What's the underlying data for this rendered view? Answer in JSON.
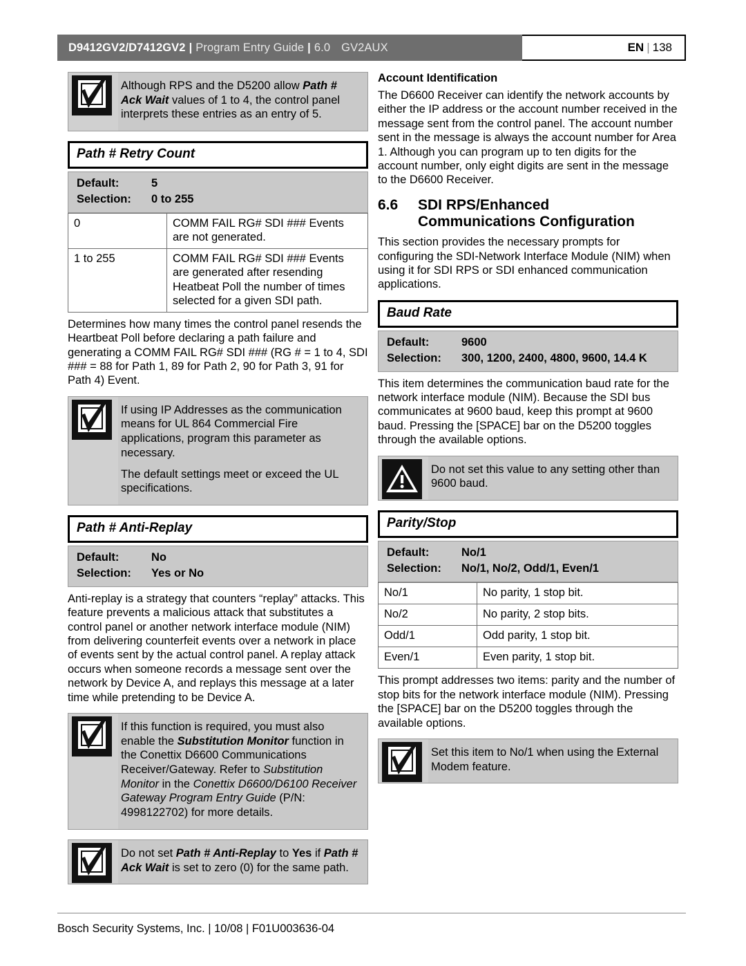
{
  "header": {
    "product": "D9412GV2/D7412GV2",
    "separator": "|",
    "guide": "Program Entry Guide",
    "version": "6.0",
    "aux": "GV2AUX",
    "language": "EN",
    "page_number": "138",
    "bar_color": "#6e6e6e"
  },
  "footer": {
    "text": "Bosch Security Systems, Inc. | 10/08 | F01U003636-04"
  },
  "left_column": {
    "note_ack_wait": {
      "icon": "notice-checkbox-icon",
      "text_run_1": "Although RPS and the D5200 allow ",
      "text_bold_1": "Path # Ack Wait",
      "text_run_2": " values of 1 to 4, the control panel interprets these entries as an entry of 5."
    },
    "retry_count": {
      "title": "Path # Retry Count",
      "default_label": "Default:",
      "default_value": "5",
      "selection_label": "Selection:",
      "selection_value": "0 to 255",
      "rows": [
        {
          "value": "0",
          "description": "COMM FAIL RG# SDI ### Events are not generated."
        },
        {
          "value": "1 to 255",
          "description": "COMM FAIL RG# SDI ### Events are generated after resending Heatbeat Poll the number of times selected for a given SDI path."
        }
      ],
      "body": "Determines how many times the control panel resends the Heartbeat Poll before declaring a path failure and generating a COMM FAIL RG# SDI ### (RG # = 1 to 4, SDI ### = 88 for Path 1, 89 for Path 2, 90 for Path 3, 91 for Path 4) Event."
    },
    "note_ul864": {
      "icon": "notice-checkbox-icon",
      "paragraph_1": "If using IP Addresses as the communication means for UL 864 Commercial Fire applications, program this parameter as necessary.",
      "paragraph_2": "The default settings meet or exceed the UL specifications."
    },
    "anti_replay": {
      "title": "Path # Anti-Replay",
      "default_label": "Default:",
      "default_value": "No",
      "selection_label": "Selection:",
      "selection_value": "Yes or No",
      "body": "Anti-replay is a strategy that counters “replay” attacks. This feature prevents a malicious attack that substitutes a control panel or another network interface module (NIM) from delivering counterfeit events over a network in place of events sent by the actual control panel. A replay attack occurs when someone records a message sent over the network by Device A, and replays this message at a later time while pretending to be Device A."
    },
    "note_substitution": {
      "icon": "notice-checkbox-icon",
      "run_1": "If this function is required, you must also enable the ",
      "bold_1": "Substitution Monitor",
      "run_2": " function in the Conettix D6600 Communications Receiver/Gateway. Refer to ",
      "italic_1": "Substitution Monitor",
      "run_3": " in the ",
      "italic_2": "Conettix D6600/D6100 Receiver Gateway Program Entry Guide",
      "run_4": " (P/N: 4998122702) for more details."
    },
    "note_no_yes": {
      "icon": "notice-checkbox-icon",
      "run_1": "Do not set ",
      "bold_1": "Path # Anti-Replay",
      "run_2": " to ",
      "bold_2": "Yes",
      "run_3": " if ",
      "bold_3": "Path # Ack Wait",
      "run_4": " is set to zero (0) for the same path."
    }
  },
  "right_column": {
    "account_identification": {
      "heading": "Account Identification",
      "body": "The D6600 Receiver can identify the network accounts by either the IP address or the account number received in the message sent from the control panel. The account number sent in the message is always the account number for Area 1. Although you can program up to ten digits for the account number, only eight digits are sent in the message to the D6600 Receiver."
    },
    "section": {
      "number": "6.6",
      "title_line_1": "SDI RPS/Enhanced",
      "title_line_2": "Communications Configuration",
      "body": "This section provides the necessary prompts for configuring the SDI-Network Interface Module (NIM) when using it for SDI RPS or SDI enhanced communication applications."
    },
    "baud_rate": {
      "title": "Baud Rate",
      "default_label": "Default:",
      "default_value": "9600",
      "selection_label": "Selection:",
      "selection_value": "300, 1200, 2400, 4800, 9600, 14.4 K",
      "body": "This item determines the communication baud rate for the network interface module (NIM). Because the SDI bus communicates at 9600 baud, keep this prompt at 9600 baud. Pressing the [SPACE] bar on the D5200 toggles through the available options."
    },
    "warning_baud": {
      "icon": "warning-triangle-icon",
      "text": "Do not set this value to any setting other than 9600 baud."
    },
    "parity_stop": {
      "title": "Parity/Stop",
      "default_label": "Default:",
      "default_value": "No/1",
      "selection_label": "Selection:",
      "selection_value": "No/1, No/2, Odd/1, Even/1",
      "rows": [
        {
          "value": "No/1",
          "description": "No parity, 1 stop bit."
        },
        {
          "value": "No/2",
          "description": "No parity, 2 stop bits."
        },
        {
          "value": "Odd/1",
          "description": "Odd parity, 1 stop bit."
        },
        {
          "value": "Even/1",
          "description": "Even parity, 1 stop bit."
        }
      ],
      "body": "This prompt addresses two items: parity and the number of stop bits for the network interface module (NIM). Pressing the [SPACE] bar on the D5200 toggles through the available options."
    },
    "note_modem": {
      "icon": "notice-checkbox-icon",
      "text": "Set this item to No/1 when using the External Modem feature."
    }
  }
}
